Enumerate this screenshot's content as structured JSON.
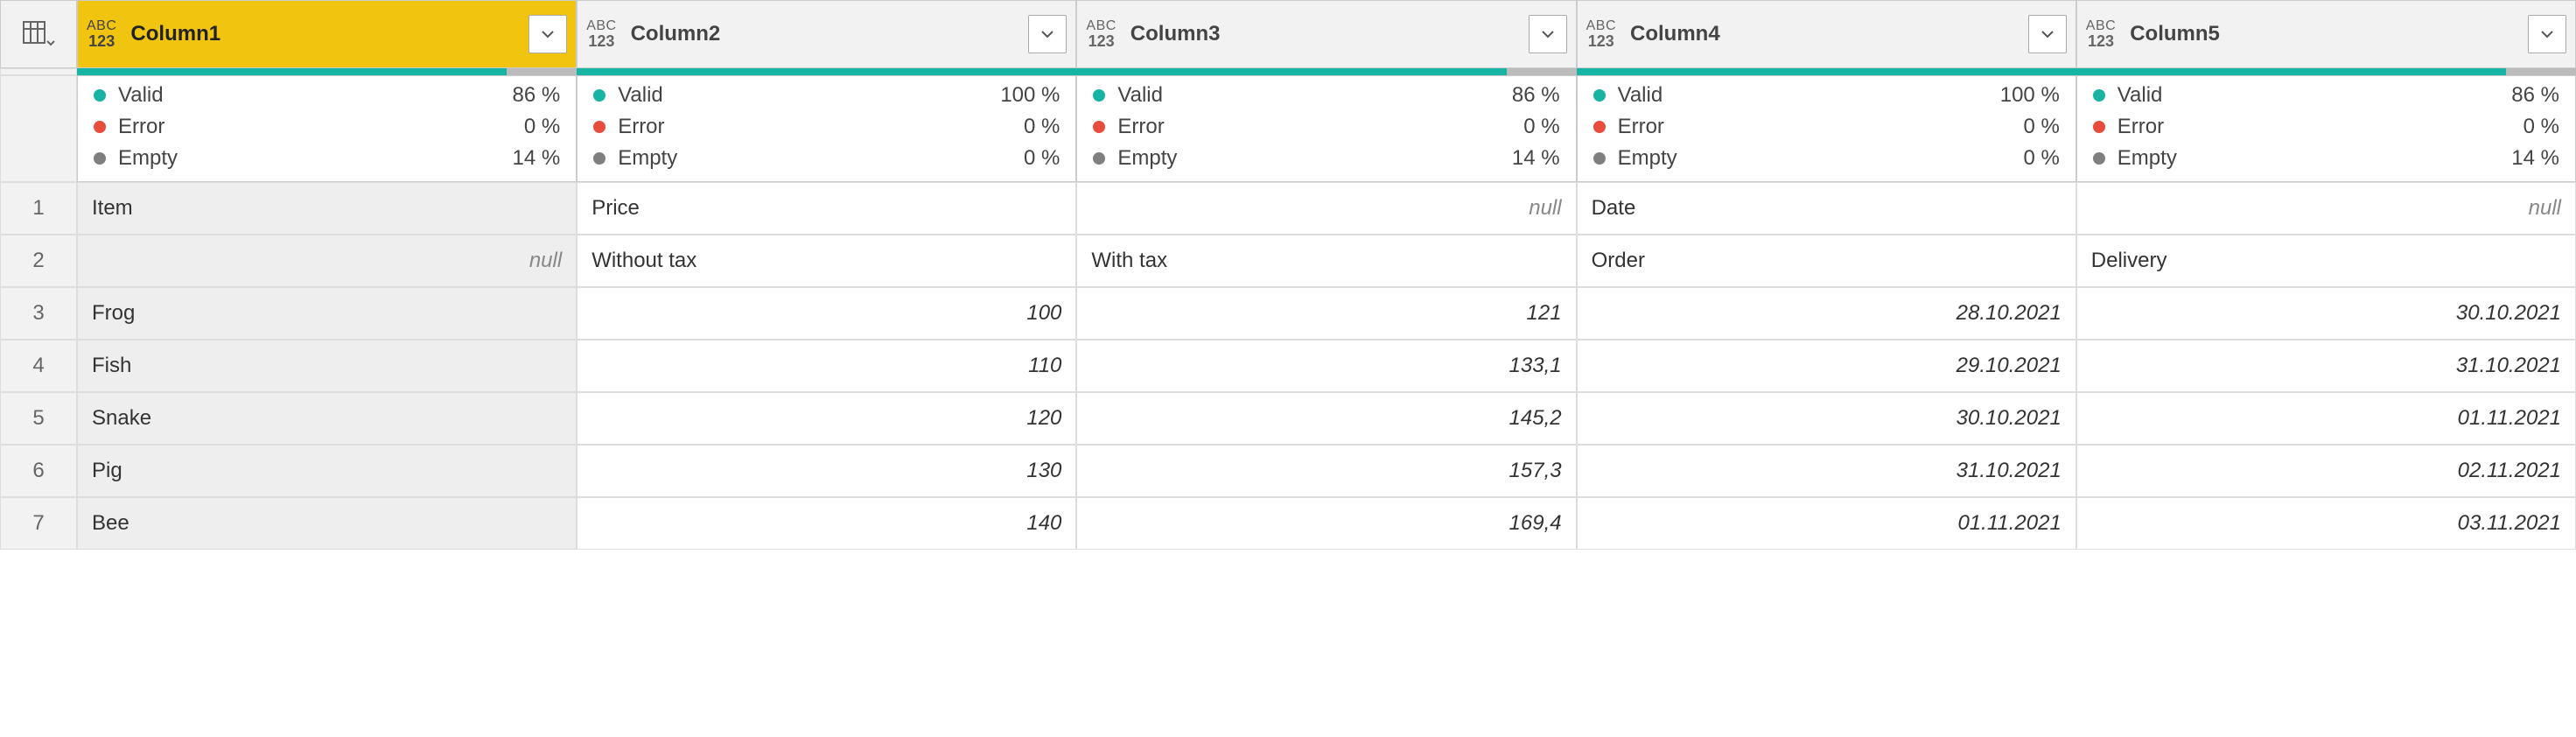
{
  "typeIcon": {
    "abc": "ABC",
    "num": "123"
  },
  "columns": [
    {
      "name": "Column1",
      "selected": true,
      "quality": {
        "valid": "86 %",
        "error": "0 %",
        "empty": "14 %",
        "validPct": 86,
        "emptyPct": 14
      }
    },
    {
      "name": "Column2",
      "selected": false,
      "quality": {
        "valid": "100 %",
        "error": "0 %",
        "empty": "0 %",
        "validPct": 100,
        "emptyPct": 0
      }
    },
    {
      "name": "Column3",
      "selected": false,
      "quality": {
        "valid": "86 %",
        "error": "0 %",
        "empty": "14 %",
        "validPct": 86,
        "emptyPct": 14
      }
    },
    {
      "name": "Column4",
      "selected": false,
      "quality": {
        "valid": "100 %",
        "error": "0 %",
        "empty": "0 %",
        "validPct": 100,
        "emptyPct": 0
      }
    },
    {
      "name": "Column5",
      "selected": false,
      "quality": {
        "valid": "86 %",
        "error": "0 %",
        "empty": "14 %",
        "validPct": 86,
        "emptyPct": 14
      }
    }
  ],
  "qualityLabels": {
    "valid": "Valid",
    "error": "Error",
    "empty": "Empty"
  },
  "nullText": "null",
  "rows": [
    {
      "num": "1",
      "cells": [
        {
          "text": "Item",
          "align": "left",
          "italic": false,
          "null": false
        },
        {
          "text": "Price",
          "align": "left",
          "italic": false,
          "null": false
        },
        {
          "text": "null",
          "align": "right",
          "italic": true,
          "null": true
        },
        {
          "text": "Date",
          "align": "left",
          "italic": false,
          "null": false
        },
        {
          "text": "null",
          "align": "right",
          "italic": true,
          "null": true
        }
      ]
    },
    {
      "num": "2",
      "cells": [
        {
          "text": "null",
          "align": "right",
          "italic": true,
          "null": true
        },
        {
          "text": "Without tax",
          "align": "left",
          "italic": false,
          "null": false
        },
        {
          "text": "With tax",
          "align": "left",
          "italic": false,
          "null": false
        },
        {
          "text": "Order",
          "align": "left",
          "italic": false,
          "null": false
        },
        {
          "text": "Delivery",
          "align": "left",
          "italic": false,
          "null": false
        }
      ]
    },
    {
      "num": "3",
      "cells": [
        {
          "text": "Frog",
          "align": "left",
          "italic": false,
          "null": false
        },
        {
          "text": "100",
          "align": "right",
          "italic": true,
          "null": false
        },
        {
          "text": "121",
          "align": "right",
          "italic": true,
          "null": false
        },
        {
          "text": "28.10.2021",
          "align": "right",
          "italic": true,
          "null": false
        },
        {
          "text": "30.10.2021",
          "align": "right",
          "italic": true,
          "null": false
        }
      ]
    },
    {
      "num": "4",
      "cells": [
        {
          "text": "Fish",
          "align": "left",
          "italic": false,
          "null": false
        },
        {
          "text": "110",
          "align": "right",
          "italic": true,
          "null": false
        },
        {
          "text": "133,1",
          "align": "right",
          "italic": true,
          "null": false
        },
        {
          "text": "29.10.2021",
          "align": "right",
          "italic": true,
          "null": false
        },
        {
          "text": "31.10.2021",
          "align": "right",
          "italic": true,
          "null": false
        }
      ]
    },
    {
      "num": "5",
      "cells": [
        {
          "text": "Snake",
          "align": "left",
          "italic": false,
          "null": false
        },
        {
          "text": "120",
          "align": "right",
          "italic": true,
          "null": false
        },
        {
          "text": "145,2",
          "align": "right",
          "italic": true,
          "null": false
        },
        {
          "text": "30.10.2021",
          "align": "right",
          "italic": true,
          "null": false
        },
        {
          "text": "01.11.2021",
          "align": "right",
          "italic": true,
          "null": false
        }
      ]
    },
    {
      "num": "6",
      "cells": [
        {
          "text": "Pig",
          "align": "left",
          "italic": false,
          "null": false
        },
        {
          "text": "130",
          "align": "right",
          "italic": true,
          "null": false
        },
        {
          "text": "157,3",
          "align": "right",
          "italic": true,
          "null": false
        },
        {
          "text": "31.10.2021",
          "align": "right",
          "italic": true,
          "null": false
        },
        {
          "text": "02.11.2021",
          "align": "right",
          "italic": true,
          "null": false
        }
      ]
    },
    {
      "num": "7",
      "cells": [
        {
          "text": "Bee",
          "align": "left",
          "italic": false,
          "null": false
        },
        {
          "text": "140",
          "align": "right",
          "italic": true,
          "null": false
        },
        {
          "text": "169,4",
          "align": "right",
          "italic": true,
          "null": false
        },
        {
          "text": "01.11.2021",
          "align": "right",
          "italic": true,
          "null": false
        },
        {
          "text": "03.11.2021",
          "align": "right",
          "italic": true,
          "null": false
        }
      ]
    }
  ]
}
